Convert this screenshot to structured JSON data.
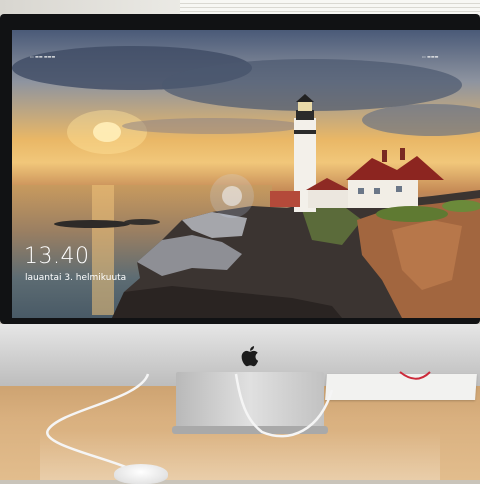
{
  "lockscreen": {
    "time": "13.40",
    "date": "lauantai 3. helmikuuta"
  },
  "colors": {
    "screen_text": "#ffffff",
    "bezel": "#111214",
    "chin": "#cfcfcf"
  },
  "icons": {
    "apple": "apple-logo-icon"
  }
}
